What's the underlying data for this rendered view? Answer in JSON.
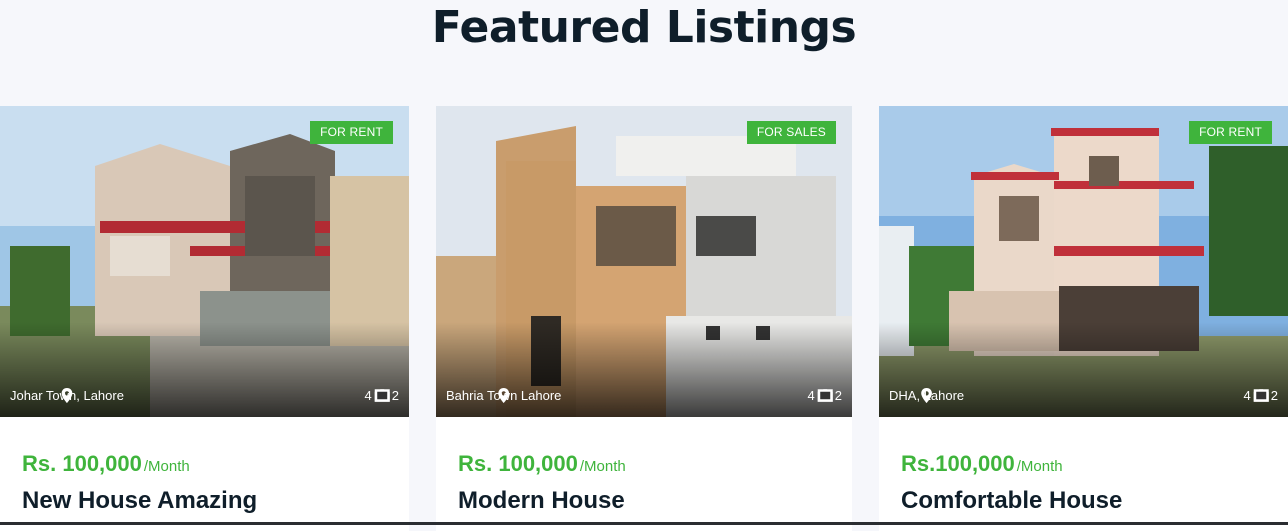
{
  "section": {
    "title": "Featured Listings"
  },
  "listings": [
    {
      "badge": "FOR RENT",
      "location": "Johar Town, Lahore",
      "photos": "4",
      "rooms": "2",
      "price": "Rs. 100,000",
      "per": "/Month",
      "title": "New House Amazing"
    },
    {
      "badge": "FOR SALES",
      "location": "Bahria Town Lahore",
      "photos": "4",
      "rooms": "2",
      "price": "Rs. 100,000",
      "per": "/Month",
      "title": "Modern House"
    },
    {
      "badge": "FOR RENT",
      "location": "DHA, Lahore",
      "photos": "4",
      "rooms": "2",
      "price": "Rs.100,000",
      "per": "/Month",
      "title": "Comfortable House"
    }
  ],
  "colors": {
    "accent": "#3fb43c",
    "heading": "#0f1e2a",
    "background": "#f6f7fb"
  },
  "icons": {
    "location": "map-pin-icon",
    "photos": "camera-icon",
    "rooms": "film-icon"
  }
}
